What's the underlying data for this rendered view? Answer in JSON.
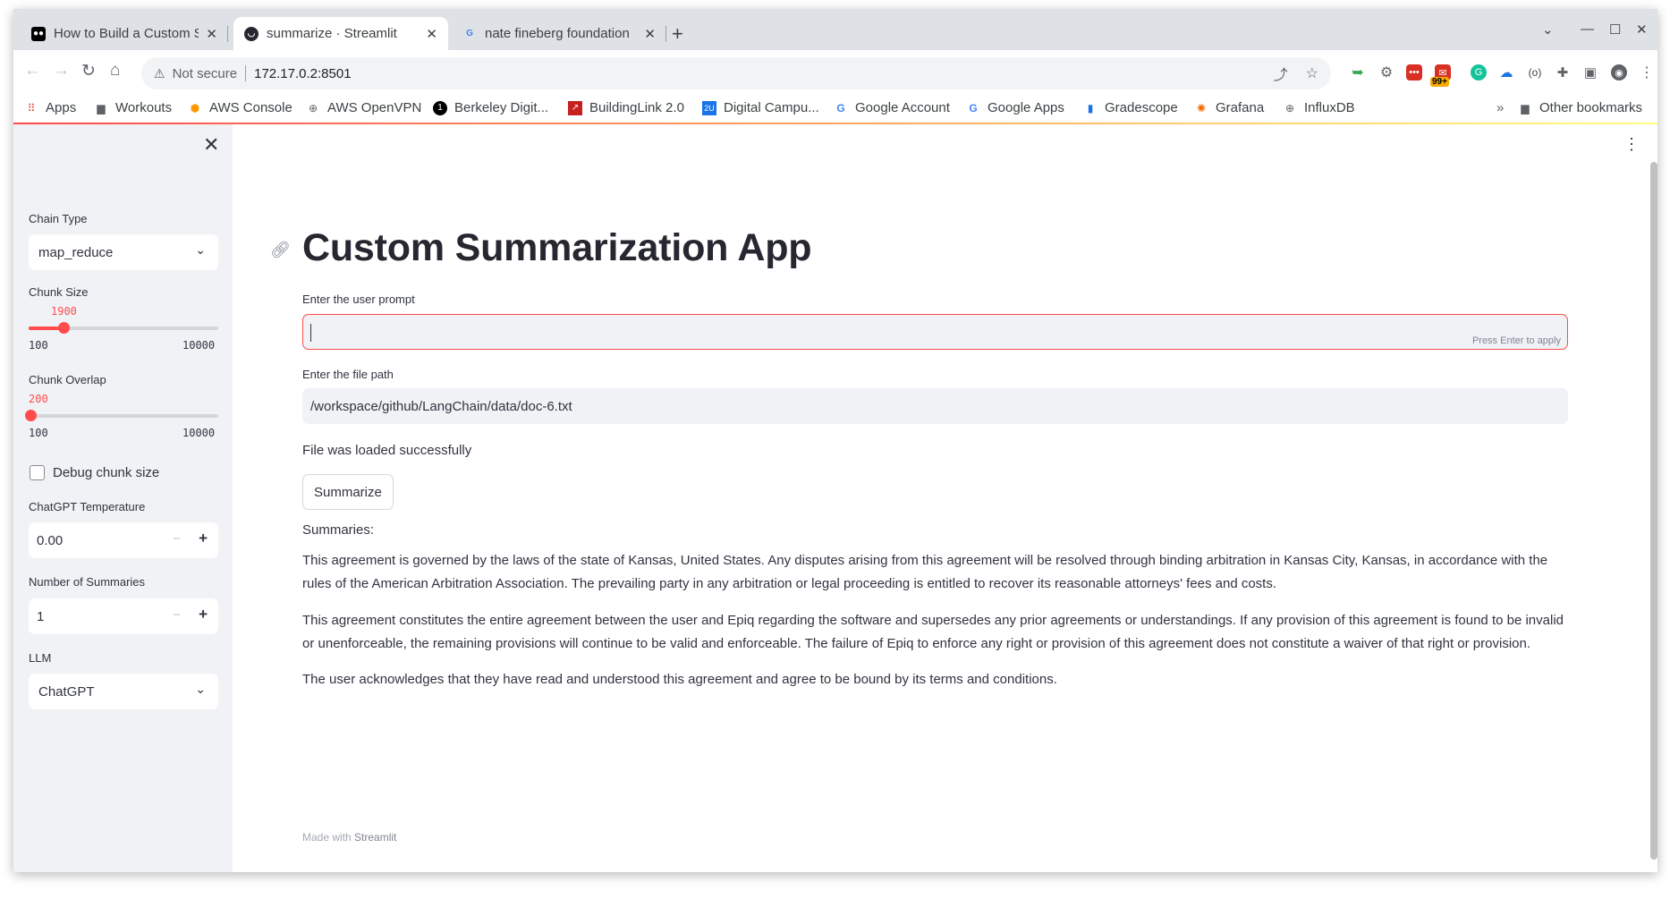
{
  "browser": {
    "tabs": [
      {
        "title": "How to Build a Custom Su",
        "favicon": "medium-icon"
      },
      {
        "title": "summarize · Streamlit",
        "favicon": "streamlit-icon"
      },
      {
        "title": "nate fineberg foundation",
        "favicon": "google-icon"
      }
    ],
    "omnibox": {
      "security": "Not secure",
      "url": "172.17.0.2:8501"
    },
    "extension_badge": "99+",
    "bookmarks": [
      "Apps",
      "Workouts",
      "AWS Console",
      "AWS OpenVPN",
      "Berkeley Digit...",
      "BuildingLink 2.0",
      "Digital Campu...",
      "Google Account",
      "Google Apps",
      "Gradescope",
      "Grafana",
      "InfluxDB"
    ],
    "bookmarks_overflow": "»",
    "other_bookmarks": "Other bookmarks"
  },
  "sidebar": {
    "chain_type": {
      "label": "Chain Type",
      "value": "map_reduce"
    },
    "chunk_size": {
      "label": "Chunk Size",
      "value": "1900",
      "min": "100",
      "max": "10000",
      "fraction": 0.182
    },
    "chunk_overlap": {
      "label": "Chunk Overlap",
      "value": "200",
      "min": "100",
      "max": "10000",
      "fraction": 0.01
    },
    "debug": {
      "label": "Debug chunk size",
      "checked": false
    },
    "temperature": {
      "label": "ChatGPT Temperature",
      "value": "0.00"
    },
    "num_summaries": {
      "label": "Number of Summaries",
      "value": "1"
    },
    "llm": {
      "label": "LLM",
      "value": "ChatGPT"
    }
  },
  "main": {
    "title": "Custom Summarization App",
    "prompt_label": "Enter the user prompt",
    "prompt_value": "",
    "prompt_hint": "Press Enter to apply",
    "filepath_label": "Enter the file path",
    "filepath_value": "/workspace/github/LangChain/data/doc-6.txt",
    "load_status": "File was loaded successfully",
    "summarize_button": "Summarize",
    "summaries_heading": "Summaries:",
    "summaries": [
      "This agreement is governed by the laws of the state of Kansas, United States. Any disputes arising from this agreement will be resolved through binding arbitration in Kansas City, Kansas, in accordance with the rules of the American Arbitration Association. The prevailing party in any arbitration or legal proceeding is entitled to recover its reasonable attorneys' fees and costs.",
      "This agreement constitutes the entire agreement between the user and Epiq regarding the software and supersedes any prior agreements or understandings. If any provision of this agreement is found to be invalid or unenforceable, the remaining provisions will continue to be valid and enforceable. The failure of Epiq to enforce any right or provision of this agreement does not constitute a waiver of that right or provision.",
      "The user acknowledges that they have read and understood this agreement and agree to be bound by its terms and conditions."
    ],
    "footer_prefix": "Made with",
    "footer_link": "Streamlit"
  },
  "colors": {
    "accent": "#ff4b4b",
    "sidebar_bg": "#f0f2f6",
    "text": "#31333f"
  }
}
